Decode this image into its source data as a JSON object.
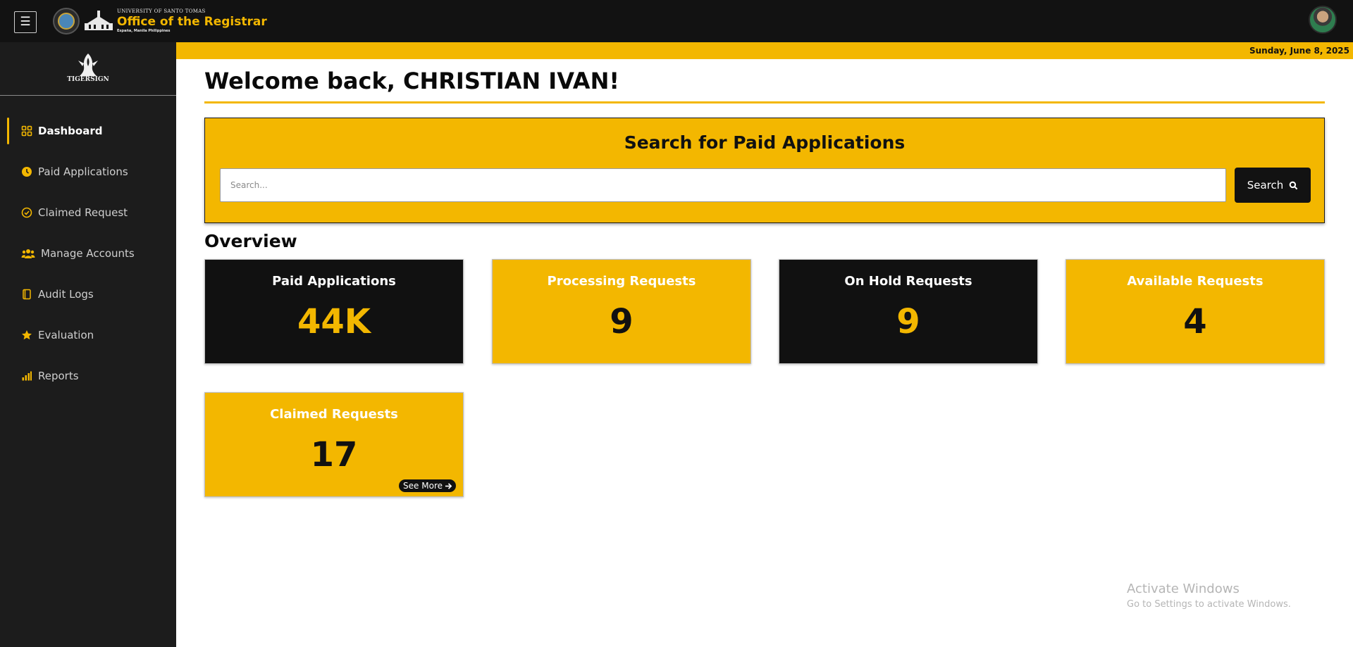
{
  "header": {
    "menu_glyph": "☰",
    "university": "UNIVERSITY OF SANTO TOMAS",
    "office": "Office of the Registrar",
    "location": "España, Manila Philippines"
  },
  "date_bar": {
    "date": "Sunday, June 8, 2025"
  },
  "sidebar": {
    "logo_text": "TIGERSIGN",
    "items": [
      {
        "label": "Dashboard",
        "icon": "grid-icon"
      },
      {
        "label": "Paid Applications",
        "icon": "clock-icon"
      },
      {
        "label": "Claimed Request",
        "icon": "check-circle-icon"
      },
      {
        "label": "Manage Accounts",
        "icon": "users-icon"
      },
      {
        "label": "Audit Logs",
        "icon": "book-icon"
      },
      {
        "label": "Evaluation",
        "icon": "star-icon"
      },
      {
        "label": "Reports",
        "icon": "bar-chart-icon"
      }
    ]
  },
  "main": {
    "welcome": "Welcome back, CHRISTIAN IVAN!",
    "search": {
      "title": "Search for Paid Applications",
      "placeholder": "Search...",
      "button_label": "Search"
    },
    "overview_title": "Overview",
    "cards": [
      {
        "title": "Paid Applications",
        "value": "44K"
      },
      {
        "title": "Processing Requests",
        "value": "9"
      },
      {
        "title": "On Hold Requests",
        "value": "9"
      },
      {
        "title": "Available Requests",
        "value": "4"
      },
      {
        "title": "Claimed Requests",
        "value": "17",
        "link": "See More"
      }
    ]
  },
  "watermark": {
    "line1": "Activate Windows",
    "line2": "Go to Settings to activate Windows."
  },
  "colors": {
    "accent": "#f3b700",
    "dark": "#111111",
    "sidebar": "#1c1c1c"
  }
}
